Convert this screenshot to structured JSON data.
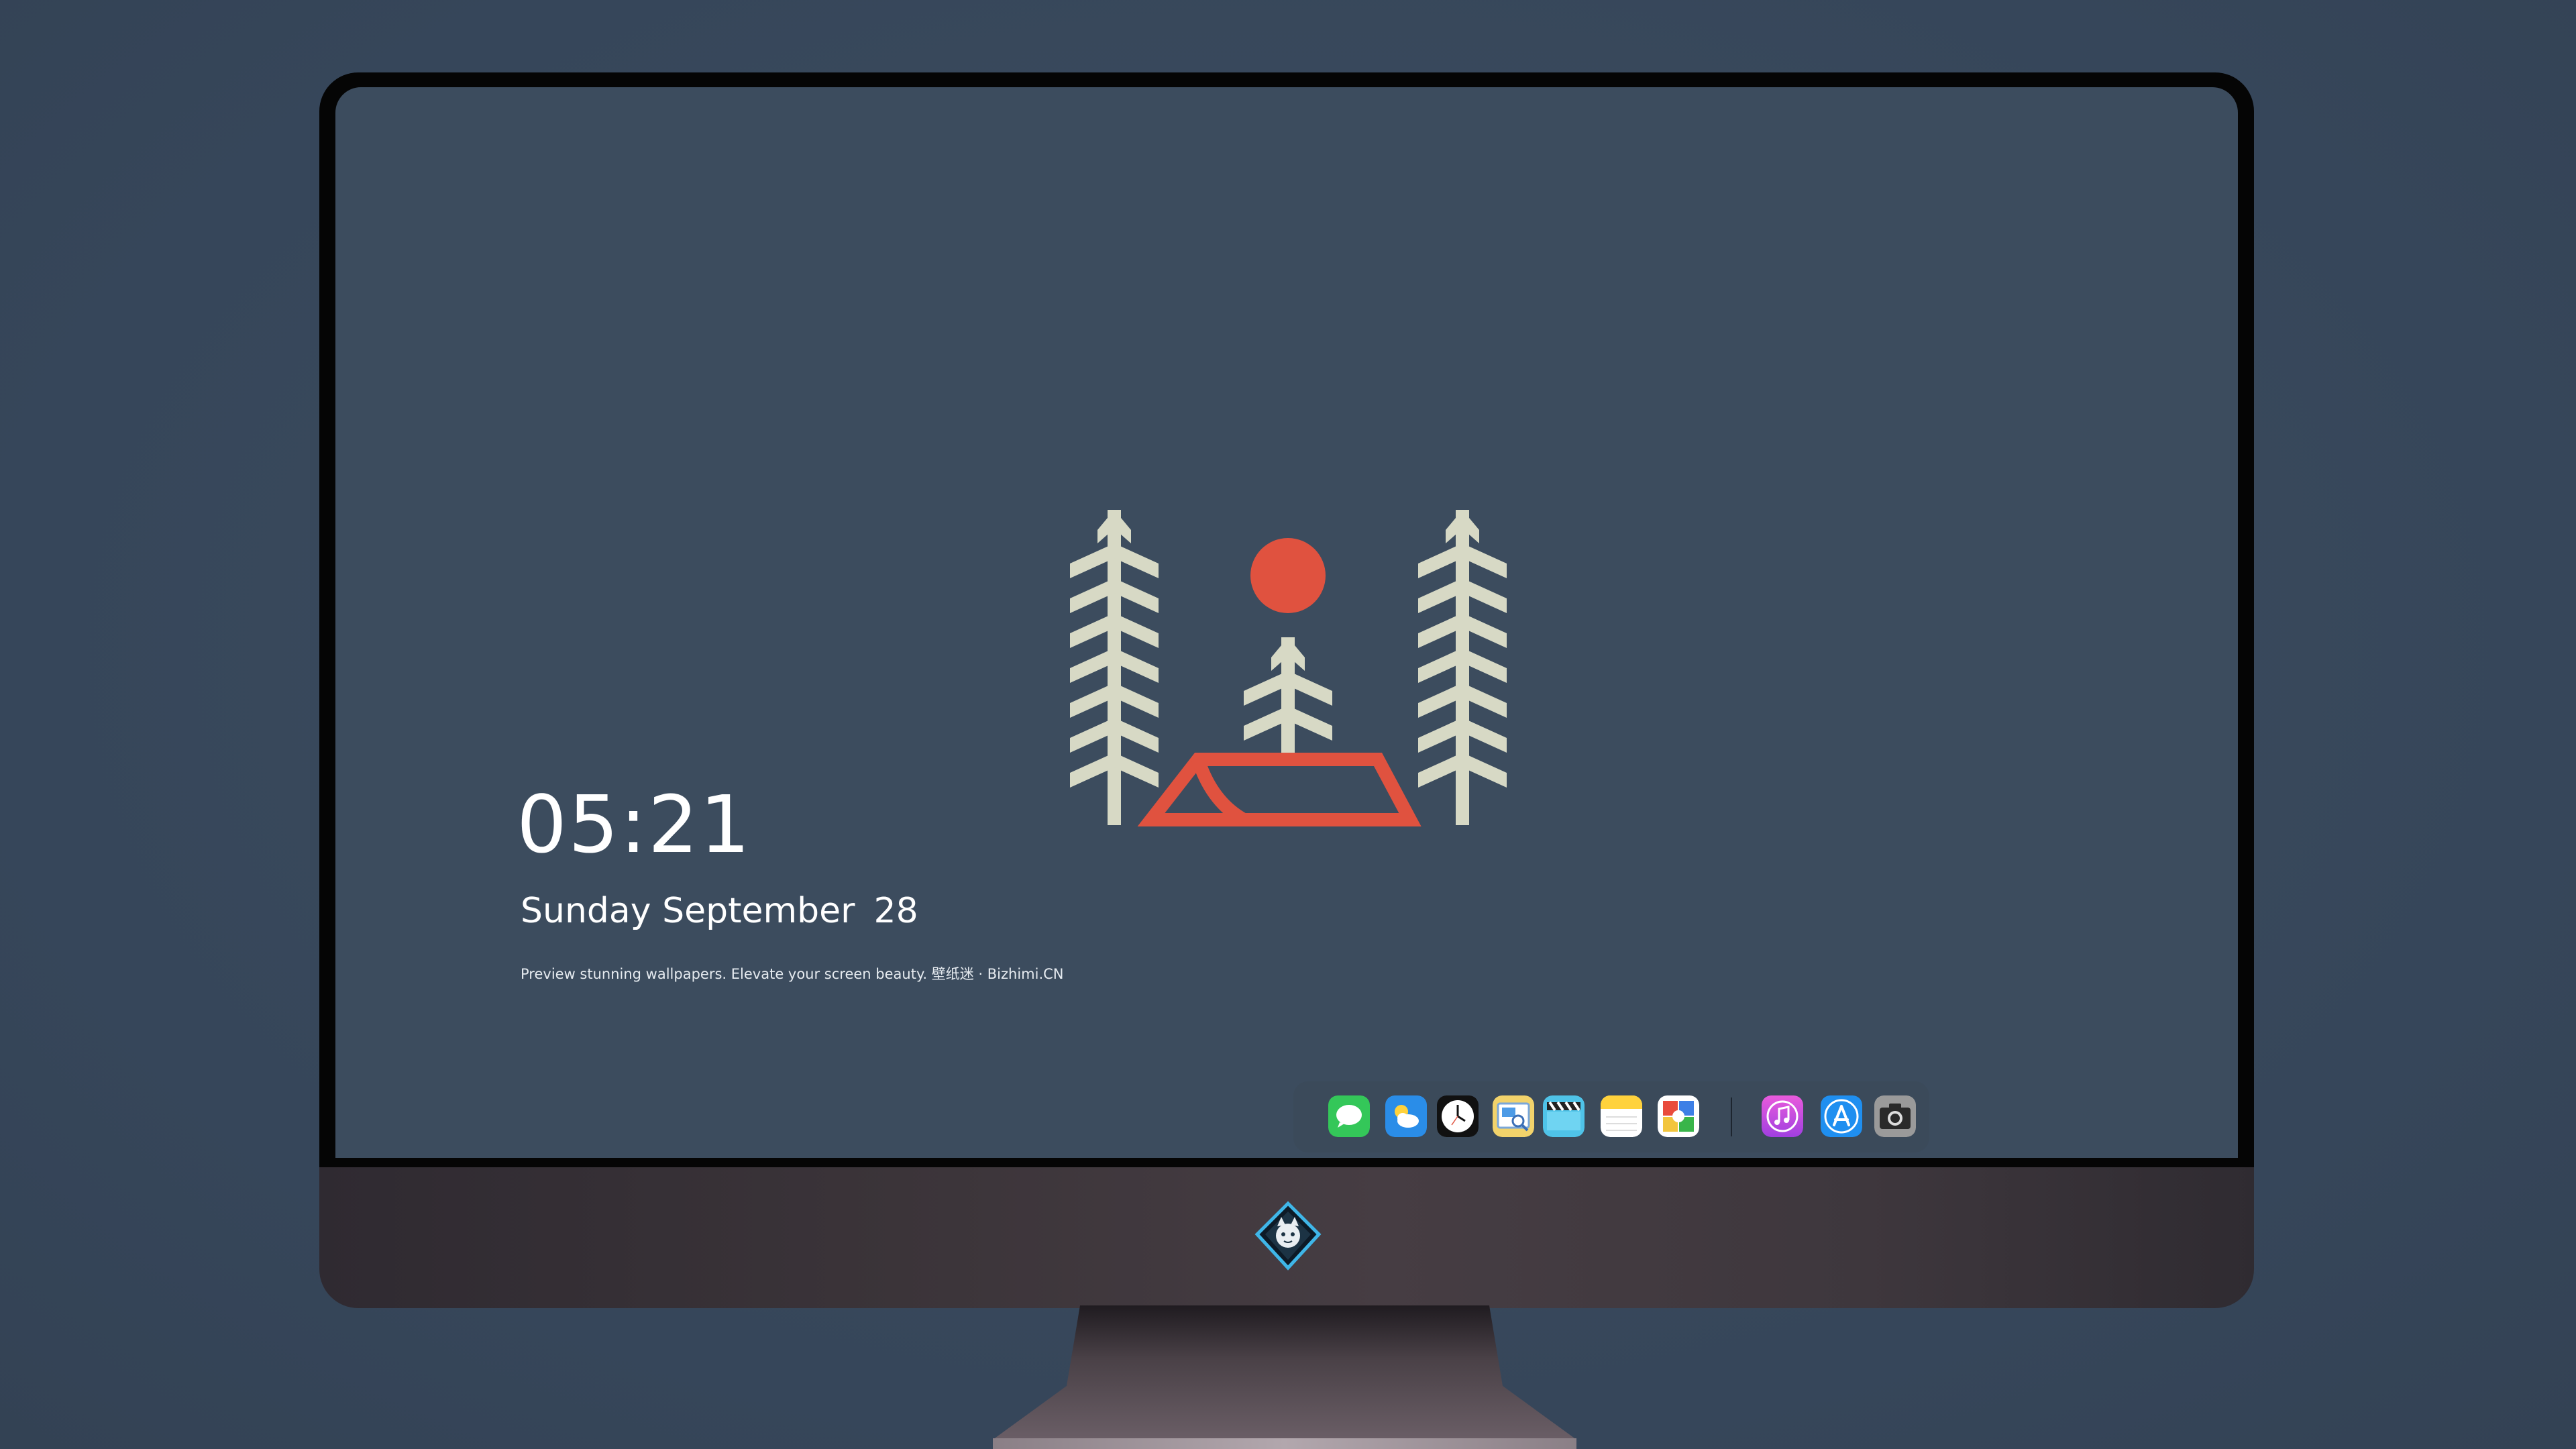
{
  "clock": {
    "time": "05:21",
    "weekday": "Sunday",
    "month": "September",
    "day": "28"
  },
  "tagline": "Preview stunning wallpapers. Elevate your screen beauty. 壁纸迷 · Bizhimi.CN",
  "wallpaper": {
    "tree_color": "#d7d9c5",
    "accent_color": "#e0523f",
    "background_color": "#3c4c5e"
  },
  "dock": {
    "apps": [
      {
        "name": "messages-icon"
      },
      {
        "name": "weather-icon"
      },
      {
        "name": "clock-icon"
      },
      {
        "name": "preview-icon"
      },
      {
        "name": "video-editor-icon"
      },
      {
        "name": "notes-icon"
      },
      {
        "name": "photo-booth-icon"
      },
      {
        "name": "music-icon"
      },
      {
        "name": "app-store-icon"
      },
      {
        "name": "camera-icon"
      }
    ]
  }
}
